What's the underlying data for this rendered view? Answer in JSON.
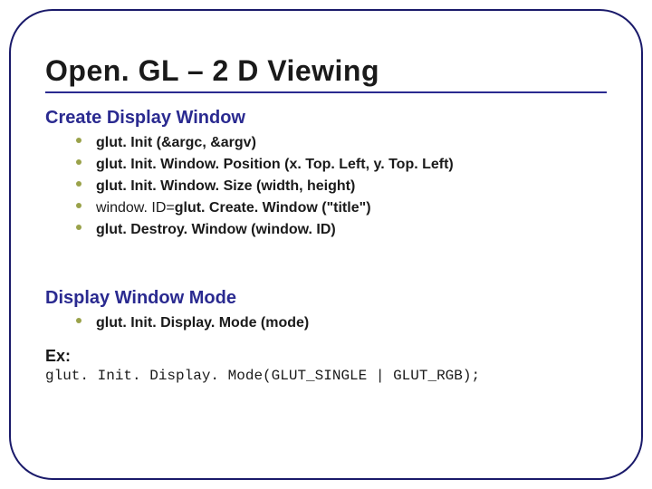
{
  "title": "Open. GL – 2 D Viewing",
  "section1": {
    "heading": "Create Display Window",
    "items": [
      {
        "pre": "",
        "bold1": "glut. Init (&argc, &argv)",
        "post": ""
      },
      {
        "pre": "",
        "bold1": "glut. Init. Window. Position (x. Top. Left, y. Top. Left)",
        "post": ""
      },
      {
        "pre": "",
        "bold1": "glut. Init. Window. Size (width, height)",
        "post": ""
      },
      {
        "pre": "window. ID=",
        "bold1": "glut. Create. Window (\"title\")",
        "post": ""
      },
      {
        "pre": "",
        "bold1": "glut. Destroy. Window ",
        "post": "(window. ID)"
      }
    ]
  },
  "section2": {
    "heading": "Display Window Mode",
    "items": [
      {
        "pre": "",
        "bold1": "glut. Init. Display. Mode (mode)",
        "post": ""
      }
    ]
  },
  "example": {
    "label": "Ex:",
    "code": "glut. Init. Display. Mode(GLUT_SINGLE | GLUT_RGB);"
  }
}
